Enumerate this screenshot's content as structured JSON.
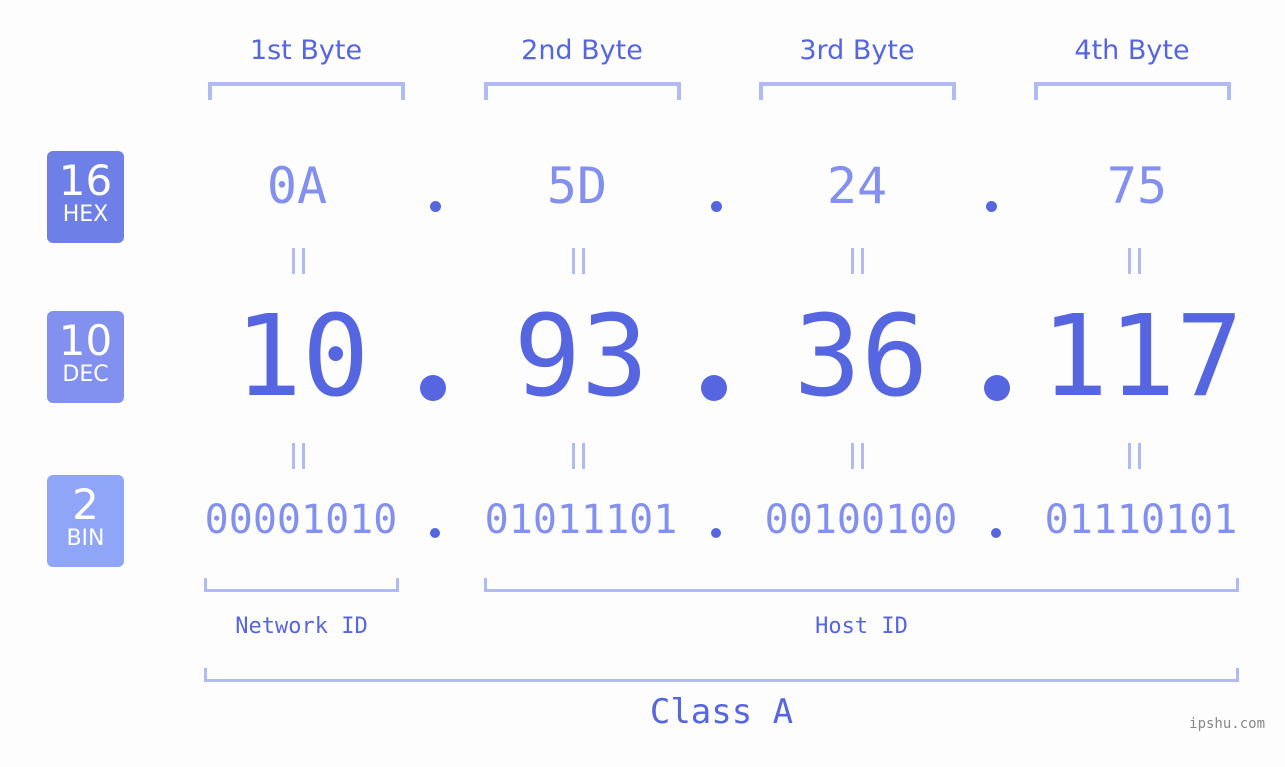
{
  "byte_headers": [
    "1st Byte",
    "2nd Byte",
    "3rd Byte",
    "4th Byte"
  ],
  "badges": [
    {
      "number": "16",
      "label": "HEX",
      "color": "#6e7fe8"
    },
    {
      "number": "10",
      "label": "DEC",
      "color": "#8290f0"
    },
    {
      "number": "2",
      "label": "BIN",
      "color": "#8fa6f8"
    }
  ],
  "hex": [
    "0A",
    "5D",
    "24",
    "75"
  ],
  "dec": [
    "10",
    "93",
    "36",
    "117"
  ],
  "bin": [
    "00001010",
    "01011101",
    "00100100",
    "01110101"
  ],
  "network_id_label": "Network ID",
  "host_id_label": "Host ID",
  "class_label": "Class A",
  "watermark": "ipshu.com",
  "colors": {
    "primary": "#5566e0",
    "secondary": "#8390ee",
    "bracket": "#b0bbf6",
    "background": "#fcfdfc"
  }
}
